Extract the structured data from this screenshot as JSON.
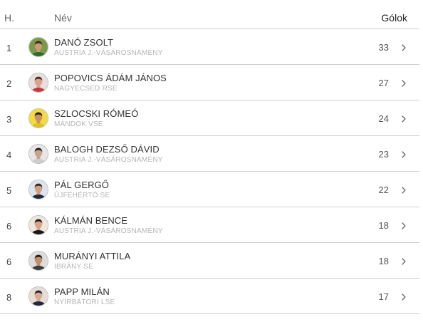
{
  "header": {
    "rank_label": "H.",
    "name_label": "Név",
    "goals_label": "Gólok"
  },
  "players": [
    {
      "rank": "1",
      "name": "DANÓ ZSOLT",
      "club": "AUSTRIA J.-VÁSÁROSNAMÉNY",
      "goals": "33",
      "avatar_bg": "#7a9a4a",
      "skin": "#c99a78",
      "hair": "#3a2a1e",
      "shirt": "#2f6b2f"
    },
    {
      "rank": "2",
      "name": "POPOVICS ÁDÁM JÁNOS",
      "club": "NAGYECSED RSE",
      "goals": "27",
      "avatar_bg": "#e8dede",
      "skin": "#d9a38e",
      "hair": "#4a2e22",
      "shirt": "#c43a3a"
    },
    {
      "rank": "3",
      "name": "SZLOCSKI RÓMEÓ",
      "club": "MÁNDOK VSE",
      "goals": "24",
      "avatar_bg": "#f2dc3a",
      "skin": "#c98f6a",
      "hair": "#2a1e18",
      "shirt": "#e0c020"
    },
    {
      "rank": "4",
      "name": "BALOGH DEZSŐ DÁVID",
      "club": "AUSTRIA J.-VÁSÁROSNAMÉNY",
      "goals": "23",
      "avatar_bg": "#e6e6e6",
      "skin": "#c9a48c",
      "hair": "#222222",
      "shirt": "#cccccc"
    },
    {
      "rank": "5",
      "name": "PÁL GERGŐ",
      "club": "ÚJFEHÉRTÓ SE",
      "goals": "22",
      "avatar_bg": "#dde3ea",
      "skin": "#cf9f82",
      "hair": "#2b2b2b",
      "shirt": "#1f2a3a"
    },
    {
      "rank": "6",
      "name": "KÁLMÁN BENCE",
      "club": "AUSTRIA J.-VÁSÁROSNAMÉNY",
      "goals": "18",
      "avatar_bg": "#efe6dc",
      "skin": "#d6a588",
      "hair": "#1f1a16",
      "shirt": "#1a1a1a"
    },
    {
      "rank": "6",
      "name": "MURÁNYI ATTILA",
      "club": "IBRÁNY SE",
      "goals": "18",
      "avatar_bg": "#dcdcdc",
      "skin": "#c08e6e",
      "hair": "#2a2018",
      "shirt": "#3a3a3a"
    },
    {
      "rank": "8",
      "name": "PAPP MILÁN",
      "club": "NYÍRBÁTORI LSE",
      "goals": "17",
      "avatar_bg": "#e8ddd4",
      "skin": "#d8a890",
      "hair": "#2a2230",
      "shirt": "#1e2a44"
    }
  ]
}
